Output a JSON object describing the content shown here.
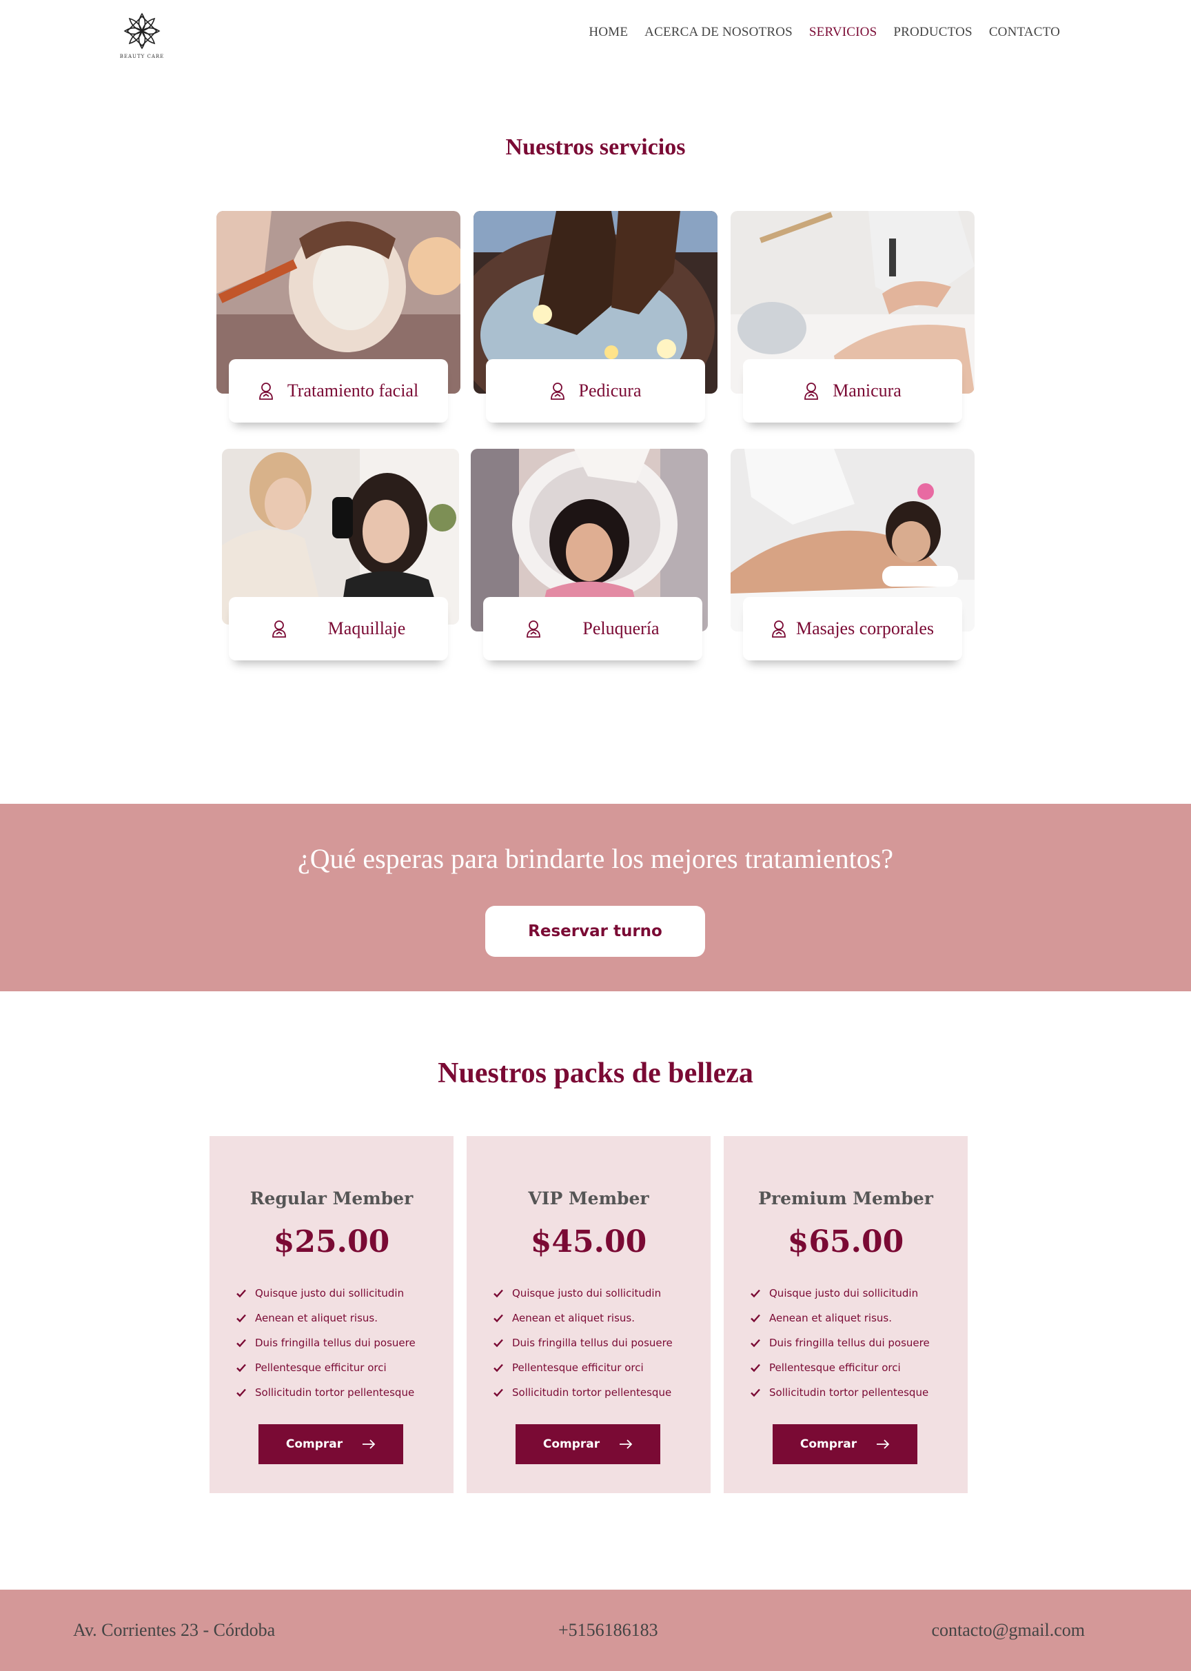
{
  "brand": {
    "logo_text": "BEAUTY CARE"
  },
  "nav": {
    "items": [
      "HOME",
      "ACERCA DE NOSOTROS",
      "SERVICIOS",
      "PRODUCTOS",
      "CONTACTO"
    ],
    "active": "SERVICIOS"
  },
  "services": {
    "title": "Nuestros servicios",
    "items": [
      {
        "label": "Tratamiento facial",
        "icon": "person-icon"
      },
      {
        "label": "Pedicura",
        "icon": "person-icon"
      },
      {
        "label": "Manicura",
        "icon": "person-icon"
      },
      {
        "label": "Maquillaje",
        "icon": "person-icon"
      },
      {
        "label": "Peluquería",
        "icon": "person-icon"
      },
      {
        "label": "Masajes corporales",
        "icon": "person-icon"
      }
    ]
  },
  "cta": {
    "heading": "¿Qué esperas para brindarte los mejores tratamientos?",
    "button_label": "Reservar turno"
  },
  "packs": {
    "title": "Nuestros packs de belleza",
    "features": [
      "Quisque justo dui sollicitudin",
      "Aenean et aliquet risus.",
      "Duis fringilla tellus dui posuere",
      "Pellentesque efficitur orci",
      "Sollicitudin tortor pellentesque"
    ],
    "buy_label": "Comprar",
    "items": [
      {
        "name": "Regular Member",
        "price": "$25.00"
      },
      {
        "name": "VIP Member",
        "price": "$45.00"
      },
      {
        "name": "Premium Member",
        "price": "$65.00"
      }
    ]
  },
  "footer": {
    "address": "Av. Corrientes 23 - Córdoba",
    "phone": "+5156186183",
    "email": "contacto@gmail.com"
  },
  "colors": {
    "accent": "#7a0a34",
    "band": "#d49898",
    "pack_bg": "#f2e0e2"
  }
}
